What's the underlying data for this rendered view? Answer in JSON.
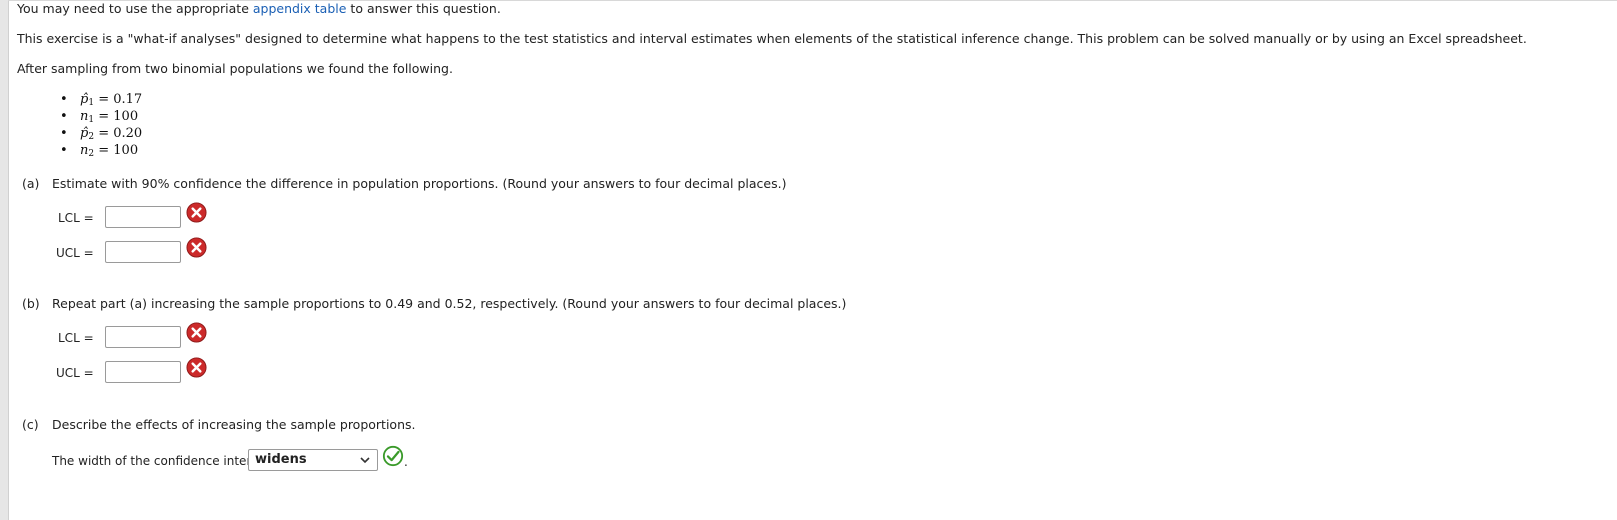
{
  "intro": {
    "line1_before": "You may need to use the appropriate ",
    "line1_link": "appendix table",
    "line1_after": " to answer this question.",
    "line2": "This exercise is a \"what-if analyses\" designed to determine what happens to the test statistics and interval estimates when elements of the statistical inference change. This problem can be solved manually or by using an Excel spreadsheet.",
    "line3": "After sampling from two binomial populations we found the following."
  },
  "givens": [
    {
      "var": "p̂",
      "sub": "1",
      "value": "= 0.17"
    },
    {
      "var": "n",
      "sub": "1",
      "value": "= 100"
    },
    {
      "var": "p̂",
      "sub": "2",
      "value": "= 0.20"
    },
    {
      "var": "n",
      "sub": "2",
      "value": "= 100"
    }
  ],
  "part_a": {
    "label": "(a)",
    "text": "Estimate with 90% confidence the difference in population proportions. (Round your answers to four decimal places.)",
    "lcl_label": "LCL =",
    "ucl_label": "UCL =",
    "lcl_value": "",
    "ucl_value": ""
  },
  "part_b": {
    "label": "(b)",
    "text": "Repeat part (a) increasing the sample proportions to 0.49 and 0.52, respectively. (Round your answers to four decimal places.)",
    "lcl_label": "LCL =",
    "ucl_label": "UCL =",
    "lcl_value": "",
    "ucl_value": ""
  },
  "part_c": {
    "label": "(c)",
    "text": "Describe the effects of increasing the sample proportions.",
    "sentence": "The width of the confidence interval",
    "selected": "widens",
    "period": "."
  },
  "colors": {
    "incorrect": "#cc2a2a",
    "correct": "#3a9a2a",
    "link": "#1a5fb4"
  }
}
